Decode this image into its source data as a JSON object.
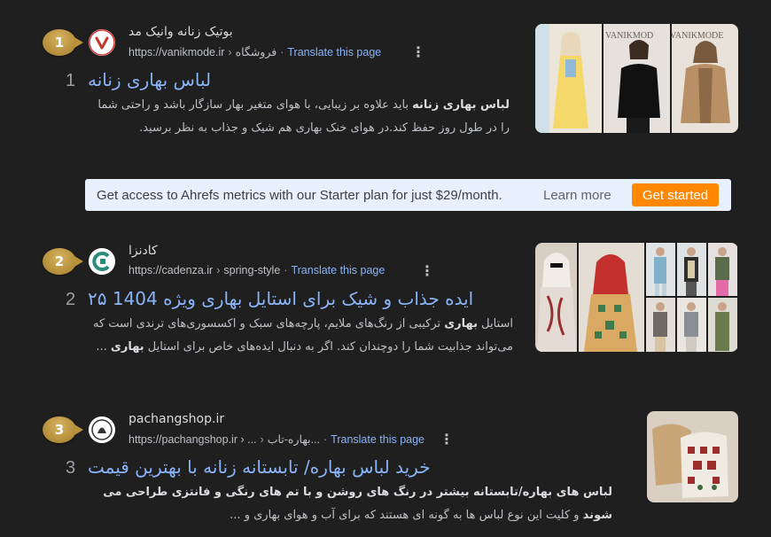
{
  "results": [
    {
      "rank_badge": "1",
      "rank_num": "1",
      "site_name": "بوتیک زنانه وانیک مد",
      "site_url": "https://vanikmode.ir",
      "breadcrumb": "فروشگاه",
      "translate": "Translate this page",
      "title": "لباس بهاری زنانه",
      "snippet_bold": "لباس بهاری زنانه",
      "snippet_rest": " باید علاوه بر زیبایی، با هوای متغیر بهار سازگار باشد و راحتی شما را در طول روز حفظ کند.در هوای خنک بهاری هم شیک و جذاب به نظر برسید.",
      "favicon_letter": "V",
      "thumb_labels": [
        "",
        "VANIKMOD",
        "VANIKMODE"
      ]
    },
    {
      "rank_badge": "2",
      "rank_num": "2",
      "site_name": "کادنزا",
      "site_url": "https://cadenza.ir",
      "breadcrumb": "spring-style",
      "translate": "Translate this page",
      "title": "۲۵ ایده جذاب و شیک برای استایل بهاری ویژه 1404",
      "snippet_part1": "استایل ",
      "snippet_bold1": "بهاری",
      "snippet_part2": " ترکیبی از رنگ‌های ملایم، پارچه‌های سبک و اکسسوری‌های ترندی است که می‌تواند جذابیت شما را دوچندان کند. اگر به دنبال ایده‌های خاص برای استایل ",
      "snippet_bold2": "بهاری",
      "snippet_part3": " ..."
    },
    {
      "rank_badge": "3",
      "rank_num": "3",
      "site_name": "pachangshop.ir",
      "site_url": "https://pachangshop.ir › ...",
      "breadcrumb": "بهاره-تاب...",
      "translate": "Translate this page",
      "title": "خرید لباس بهاره/ تابستانه زنانه با بهترین قیمت",
      "snippet_bold": "لباس های بهاره/تابستانه بیشتر در رنگ های روشن و با تم های رنگی و فانتزی طراحی می شوند",
      "snippet_rest": " و کلیت این نوع لباس ها به گونه ای هستند که برای آب و هوای بهاری و ..."
    }
  ],
  "ahrefs": {
    "message": "Get access to Ahrefs metrics with our Starter plan for just $29/month.",
    "learn_more": "Learn more",
    "cta": "Get started"
  },
  "icons": {
    "kebab": "more-vert-icon"
  },
  "colors": {
    "background": "#1f1f1f",
    "link": "#8ab4f8",
    "badge": "#b8923d",
    "cta": "#ff8800"
  }
}
